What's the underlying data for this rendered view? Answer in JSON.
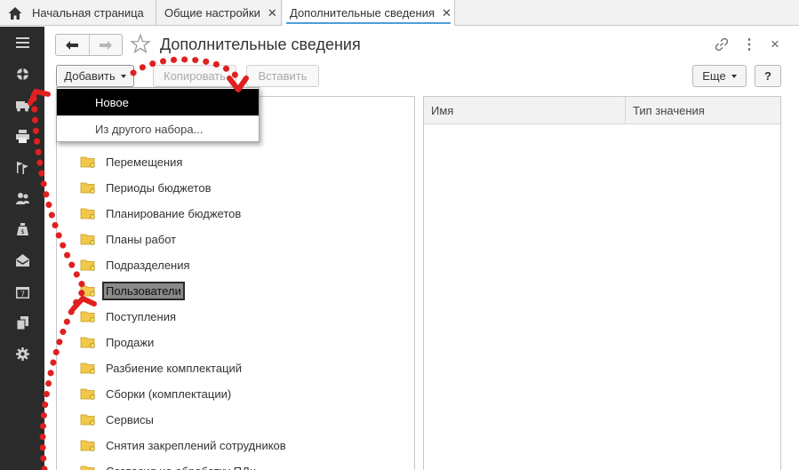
{
  "tabs": [
    {
      "label": "Начальная страница",
      "closable": false
    },
    {
      "label": "Общие настройки",
      "closable": true
    },
    {
      "label": "Дополнительные сведения",
      "closable": true,
      "active": true
    }
  ],
  "tab_close_glyph": "✕",
  "header": {
    "title": "Дополнительные сведения",
    "back_glyph": "🡐",
    "forward_glyph": "🡒",
    "menu_glyph": "⋮",
    "close_glyph": "×"
  },
  "toolbar": {
    "add_label": "Добавить",
    "copy_label": "Копировать",
    "paste_label": "Вставить",
    "more_label": "Еще",
    "help_label": "?"
  },
  "dropdown": {
    "items": [
      "Новое",
      "Из другого набора..."
    ]
  },
  "tree": {
    "items": [
      "Перемещения",
      "Периоды бюджетов",
      "Планирование бюджетов",
      "Планы работ",
      "Подразделения",
      "Пользователи",
      "Поступления",
      "Продажи",
      "Разбиение комплектаций",
      "Сборки (комплектации)",
      "Сервисы",
      "Снятия закреплений сотрудников",
      "Согласия на обработку ПДн"
    ],
    "selected_index": 5
  },
  "right_table": {
    "columns": [
      "Имя",
      "Тип значения"
    ]
  },
  "sidebar_icons": [
    "menu-icon",
    "crosshair-icon",
    "truck-icon",
    "printer-icon",
    "flags-icon",
    "people-icon",
    "moneybag-icon",
    "mail-icon",
    "calendar-icon",
    "documents-icon",
    "gear-icon"
  ],
  "colors": {
    "sidebar_bg": "#2b2b2b",
    "active_tab_underline": "#4d9fd6",
    "annotation": "#e02020",
    "folder": "#f2c84b"
  }
}
